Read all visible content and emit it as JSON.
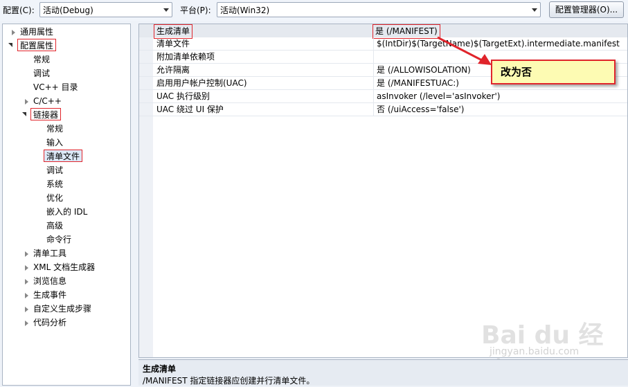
{
  "toolbar": {
    "config_label": "配置(C):",
    "config_value": "活动(Debug)",
    "platform_label": "平台(P):",
    "platform_value": "活动(Win32)",
    "manager_button": "配置管理器(O)..."
  },
  "tree": {
    "items": [
      {
        "label": "通用属性"
      },
      {
        "label": "配置属性"
      },
      {
        "label": "常规"
      },
      {
        "label": "调试"
      },
      {
        "label": "VC++ 目录"
      },
      {
        "label": "C/C++"
      },
      {
        "label": "链接器"
      },
      {
        "label": "常规"
      },
      {
        "label": "输入"
      },
      {
        "label": "清单文件"
      },
      {
        "label": "调试"
      },
      {
        "label": "系统"
      },
      {
        "label": "优化"
      },
      {
        "label": "嵌入的 IDL"
      },
      {
        "label": "高级"
      },
      {
        "label": "命令行"
      },
      {
        "label": "清单工具"
      },
      {
        "label": "XML 文档生成器"
      },
      {
        "label": "浏览信息"
      },
      {
        "label": "生成事件"
      },
      {
        "label": "自定义生成步骤"
      },
      {
        "label": "代码分析"
      }
    ]
  },
  "grid": {
    "rows": [
      {
        "name": "生成清单",
        "value": "是 (/MANIFEST)"
      },
      {
        "name": "清单文件",
        "value": "$(IntDir)$(TargetName)$(TargetExt).intermediate.manifest"
      },
      {
        "name": "附加清单依赖项",
        "value": ""
      },
      {
        "name": "允许隔离",
        "value": "是 (/ALLOWISOLATION)"
      },
      {
        "name": "启用用户帐户控制(UAC)",
        "value": "是 (/MANIFESTUAC:)"
      },
      {
        "name": "UAC 执行级别",
        "value": "asInvoker (/level='asInvoker')"
      },
      {
        "name": "UAC 绕过 UI 保护",
        "value": "否 (/uiAccess='false')"
      }
    ]
  },
  "description": {
    "title": "生成清单",
    "text": "/MANIFEST 指定链接器应创建并行清单文件。"
  },
  "callout": {
    "text": "改为否"
  },
  "watermark": {
    "logo": "Bai du 经验",
    "url": "jingyan.baidu.com"
  },
  "colors": {
    "highlight": "#e0242b",
    "callout_bg": "#fdfbb3",
    "background": "#eef2f8"
  }
}
